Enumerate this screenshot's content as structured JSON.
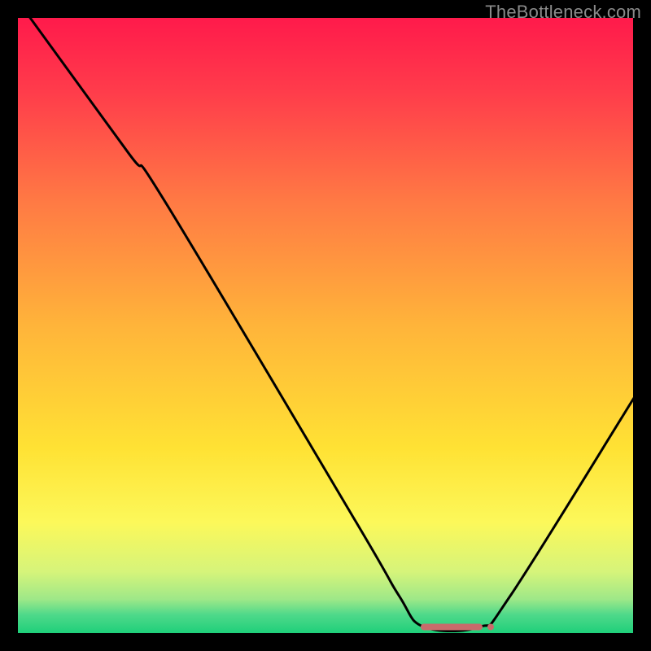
{
  "watermark": "TheBottleneck.com",
  "chart_data": {
    "type": "line",
    "title": "",
    "xlabel": "",
    "ylabel": "",
    "x_range": [
      0,
      100
    ],
    "y_range": [
      0,
      100
    ],
    "grid": false,
    "series": [
      {
        "name": "curve",
        "points": [
          {
            "x": 2,
            "y": 100
          },
          {
            "x": 18,
            "y": 78
          },
          {
            "x": 24,
            "y": 70
          },
          {
            "x": 55,
            "y": 18
          },
          {
            "x": 62,
            "y": 6
          },
          {
            "x": 66,
            "y": 1
          },
          {
            "x": 75,
            "y": 1
          },
          {
            "x": 80,
            "y": 6
          },
          {
            "x": 100,
            "y": 38
          }
        ]
      },
      {
        "name": "flat-optimum",
        "points": [
          {
            "x": 66,
            "y": 1
          },
          {
            "x": 75,
            "y": 1
          }
        ],
        "color": "#c96b6b"
      }
    ],
    "background_gradient": {
      "stops": [
        {
          "pos": 0.0,
          "color": "#ff1a4b"
        },
        {
          "pos": 0.12,
          "color": "#ff3c4b"
        },
        {
          "pos": 0.3,
          "color": "#ff7a44"
        },
        {
          "pos": 0.5,
          "color": "#ffb43a"
        },
        {
          "pos": 0.7,
          "color": "#ffe234"
        },
        {
          "pos": 0.82,
          "color": "#fcf85a"
        },
        {
          "pos": 0.9,
          "color": "#d6f47a"
        },
        {
          "pos": 0.945,
          "color": "#9ee888"
        },
        {
          "pos": 0.97,
          "color": "#4fd98a"
        },
        {
          "pos": 1.0,
          "color": "#1fcf7a"
        }
      ]
    },
    "frame_color": "#000000",
    "frame_thickness_px": 22
  }
}
